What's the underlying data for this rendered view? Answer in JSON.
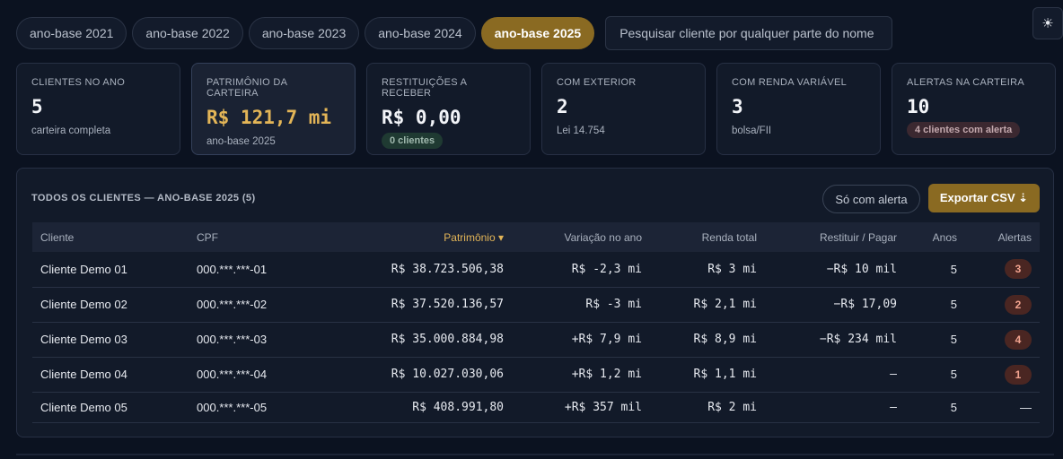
{
  "years": [
    "ano-base 2021",
    "ano-base 2022",
    "ano-base 2023",
    "ano-base 2024",
    "ano-base 2025"
  ],
  "active_year": "ano-base 2025",
  "search": {
    "placeholder": "Pesquisar cliente por qualquer parte do nome"
  },
  "theme_icon": "sun-icon",
  "cards": [
    {
      "label": "CLIENTES NO ANO",
      "value": "5",
      "sub": "carteira completa"
    },
    {
      "label": "PATRIMÔNIO DA CARTEIRA",
      "value": "R$ 121,7 mi",
      "sub": "ano-base 2025"
    },
    {
      "label": "RESTITUIÇÕES A RECEBER",
      "value": "R$ 0,00",
      "badge": "0 clientes"
    },
    {
      "label": "COM EXTERIOR",
      "value": "2",
      "sub": "Lei 14.754"
    },
    {
      "label": "COM RENDA VARIÁVEL",
      "value": "3",
      "sub": "bolsa/FII"
    },
    {
      "label": "ALERTAS NA CARTEIRA",
      "value": "10",
      "badge": "4 clientes com alerta"
    }
  ],
  "table": {
    "title": "TODOS OS CLIENTES — ANO-BASE 2025 (5)",
    "filter_label": "Só com alerta",
    "export_label": "Exportar CSV ⇣",
    "headers": {
      "cliente": "Cliente",
      "cpf": "CPF",
      "patrimonio": "Patrimônio ▾",
      "variacao": "Variação no ano",
      "renda": "Renda total",
      "restituir": "Restituir / Pagar",
      "anos": "Anos",
      "alertas": "Alertas"
    },
    "rows": [
      {
        "cliente": "Cliente Demo 01",
        "cpf": "000.***.***-01",
        "patrimonio": "R$ 38.723.506,38",
        "variacao": "R$ -2,3 mi",
        "renda": "R$ 3 mi",
        "restituir": "−R$ 10 mil",
        "anos": "5",
        "alertas": "3"
      },
      {
        "cliente": "Cliente Demo 02",
        "cpf": "000.***.***-02",
        "patrimonio": "R$ 37.520.136,57",
        "variacao": "R$ -3 mi",
        "renda": "R$ 2,1 mi",
        "restituir": "−R$ 17,09",
        "anos": "5",
        "alertas": "2"
      },
      {
        "cliente": "Cliente Demo 03",
        "cpf": "000.***.***-03",
        "patrimonio": "R$ 35.000.884,98",
        "variacao": "+R$ 7,9 mi",
        "renda": "R$ 8,9 mi",
        "restituir": "−R$ 234 mil",
        "anos": "5",
        "alertas": "4"
      },
      {
        "cliente": "Cliente Demo 04",
        "cpf": "000.***.***-04",
        "patrimonio": "R$ 10.027.030,06",
        "variacao": "+R$ 1,2 mi",
        "renda": "R$ 1,1 mi",
        "restituir": "—",
        "anos": "5",
        "alertas": "1"
      },
      {
        "cliente": "Cliente Demo 05",
        "cpf": "000.***.***-05",
        "patrimonio": "R$ 408.991,80",
        "variacao": "+R$ 357 mil",
        "renda": "R$ 2 mi",
        "restituir": "—",
        "anos": "5",
        "alertas": "—"
      }
    ]
  },
  "colors": {
    "accent": "#8a6a22",
    "gold": "#e3b557",
    "negative": "#f06a6a",
    "positive": "#41c77d"
  }
}
